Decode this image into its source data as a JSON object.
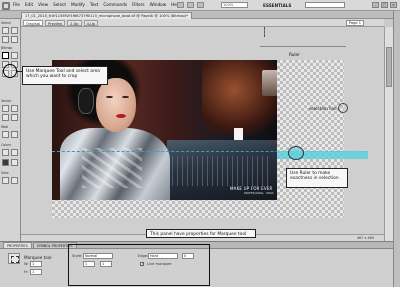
{
  "menubar": {
    "items": [
      "File",
      "Edit",
      "View",
      "Select",
      "Modify",
      "Text",
      "Commands",
      "Filters",
      "Window",
      "Help"
    ],
    "layout_value": "100%",
    "mode": "ESSENTIALS"
  },
  "document": {
    "tab_title": "17_01_2010_fc0f115692f1f66737ff0115_microphone_bowl.tif @ Page 1 @ 100% (Bitmap)*",
    "close_symbol": "x"
  },
  "viewbar": {
    "original": "Original",
    "preview": "Preview",
    "twoup": "2-Up",
    "fourup": "4-Up",
    "page": "Page 1"
  },
  "toolbar": {
    "groups": [
      "Select",
      "Bitmap",
      "Vector",
      "Web",
      "Colors",
      "View"
    ]
  },
  "stage": {
    "ruler_label": "Ruler",
    "selection_label": "selection line",
    "brand_text": "MAKE UP FOR EVER",
    "brand_sub": "PROFESSIONAL · PARIS"
  },
  "callouts": {
    "marquee": "Use Marquee Tool and select area which you want to crop",
    "ruler": "Use Ruler to make exactness in selection",
    "panel": "This panel have properties for Marquee tool"
  },
  "status": {
    "size": "467 x 460"
  },
  "properties": {
    "tabs": [
      "PROPERTIES",
      "SYMBOL PROPERTIES"
    ],
    "tool_name": "Marquee tool",
    "style_label": "Style:",
    "style_value": "Normal",
    "width_label": "W:",
    "width_value": "1",
    "height_label": "H:",
    "height_value": "1",
    "edge_label": "Edge:",
    "edge_value": "Hard",
    "feather_value": "0",
    "live_marquee_label": "Live marquee",
    "live_marquee_checked": true
  },
  "colors": {
    "accent": "#5fd0dc",
    "lips": "#b01e2a"
  }
}
